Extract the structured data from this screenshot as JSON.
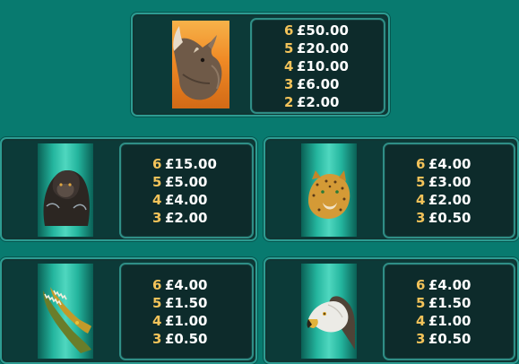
{
  "paytable": {
    "rhino": {
      "symbol_icon": "rhino-icon",
      "payouts": [
        {
          "count": "6",
          "amount": "£50.00"
        },
        {
          "count": "5",
          "amount": "£20.00"
        },
        {
          "count": "4",
          "amount": "£10.00"
        },
        {
          "count": "3",
          "amount": "£6.00"
        },
        {
          "count": "2",
          "amount": "£2.00"
        }
      ]
    },
    "gorilla": {
      "symbol_icon": "gorilla-icon",
      "payouts": [
        {
          "count": "6",
          "amount": "£15.00"
        },
        {
          "count": "5",
          "amount": "£5.00"
        },
        {
          "count": "4",
          "amount": "£4.00"
        },
        {
          "count": "3",
          "amount": "£2.00"
        }
      ]
    },
    "leopard": {
      "symbol_icon": "leopard-icon",
      "payouts": [
        {
          "count": "6",
          "amount": "£4.00"
        },
        {
          "count": "5",
          "amount": "£3.00"
        },
        {
          "count": "4",
          "amount": "£2.00"
        },
        {
          "count": "3",
          "amount": "£0.50"
        }
      ]
    },
    "crocodile": {
      "symbol_icon": "crocodile-icon",
      "payouts": [
        {
          "count": "6",
          "amount": "£4.00"
        },
        {
          "count": "5",
          "amount": "£1.50"
        },
        {
          "count": "4",
          "amount": "£1.00"
        },
        {
          "count": "3",
          "amount": "£0.50"
        }
      ]
    },
    "eagle": {
      "symbol_icon": "eagle-icon",
      "payouts": [
        {
          "count": "6",
          "amount": "£4.00"
        },
        {
          "count": "5",
          "amount": "£1.50"
        },
        {
          "count": "4",
          "amount": "£1.00"
        },
        {
          "count": "3",
          "amount": "£0.50"
        }
      ]
    }
  },
  "colors": {
    "background": "#087a6f",
    "panel": "#0c3a38",
    "count_text": "#f3c35a",
    "amount_text": "#ffffff"
  }
}
